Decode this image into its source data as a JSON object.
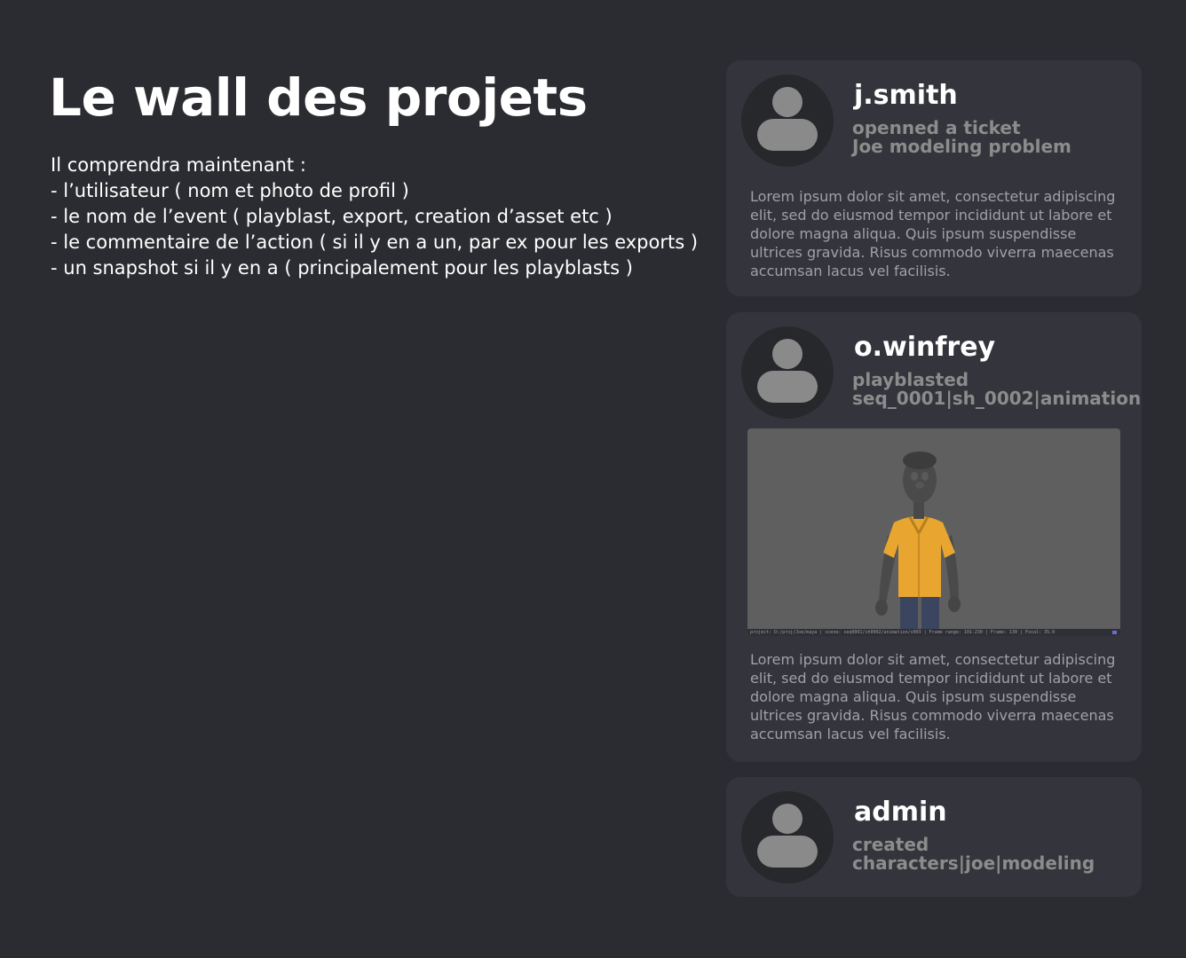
{
  "page": {
    "title": "Le wall des projets",
    "description": [
      "Il comprendra maintenant :",
      "- l’utilisateur ( nom et photo de profil )",
      "- le nom de l’event ( playblast, export, creation d’asset etc )",
      "- le commentaire de l’action ( si il y en a un, par ex pour les exports )",
      "- un snapshot si il y en a ( principalement pour les playblasts )"
    ]
  },
  "feed": [
    {
      "username": "j.smith",
      "action": "openned a ticket",
      "target": "Joe modeling problem",
      "comment": "Lorem ipsum dolor sit amet, consectetur adipiscing elit, sed do eiusmod tempor incididunt ut labore et dolore magna aliqua. Quis ipsum suspendisse ultrices gravida. Risus commodo viverra maecenas accumsan lacus vel facilisis.",
      "avatar_icon": "user-silhouette-icon"
    },
    {
      "username": "o.winfrey",
      "action": "playblasted",
      "target": "seq_0001|sh_0002|animation",
      "snapshot": {
        "description_icon": "character-render-snapshot",
        "statusbar": "project: D:/proj/Joe/maya | scene: seq0001/sh0002/animation/v003 | Frame range: 101-230 | Frame: 130 | Focal: 35.0"
      },
      "comment": "Lorem ipsum dolor sit amet, consectetur adipiscing elit, sed do eiusmod tempor incididunt ut labore et dolore magna aliqua. Quis ipsum suspendisse ultrices gravida. Risus commodo viverra maecenas accumsan lacus vel facilisis.",
      "avatar_icon": "user-silhouette-icon"
    },
    {
      "username": "admin",
      "action": "created",
      "target": "characters|joe|modeling",
      "avatar_icon": "user-silhouette-icon"
    }
  ],
  "colors": {
    "background": "#2b2c31",
    "card": "#34353c",
    "avatar_bg": "#27282c",
    "avatar_fg": "#8a8a8a",
    "muted_text": "#8c8c8c",
    "shirt": "#e8a630"
  }
}
